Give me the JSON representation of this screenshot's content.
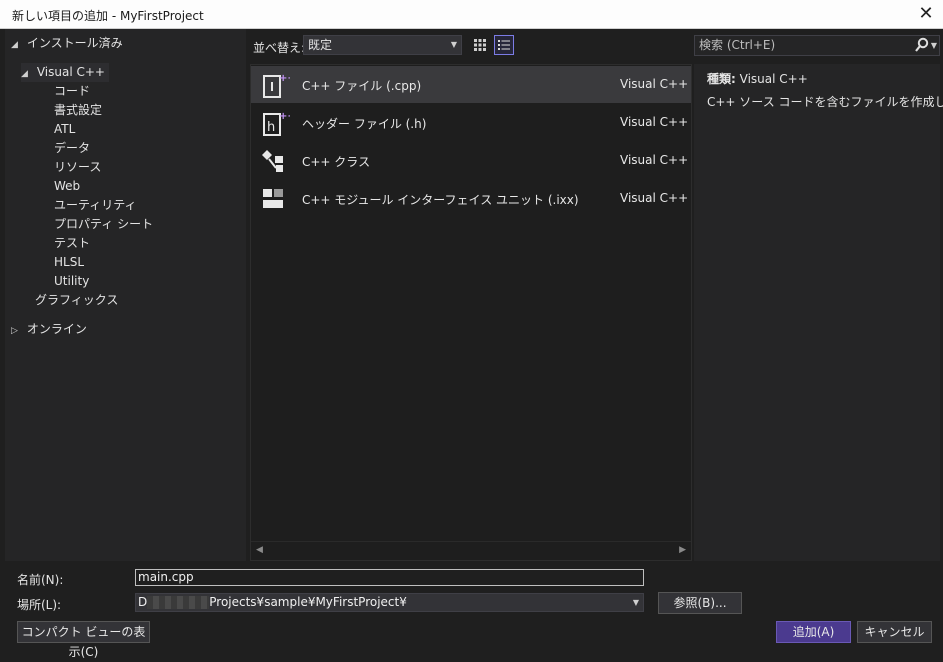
{
  "window": {
    "title": "新しい項目の追加 - MyFirstProject",
    "close_glyph": "✕"
  },
  "tree": {
    "installed": "インストール済み",
    "visual_cpp": "Visual C++",
    "children": [
      "コード",
      "書式設定",
      "ATL",
      "データ",
      "リソース",
      "Web",
      "ユーティリティ",
      "プロパティ シート",
      "テスト",
      "HLSL",
      "Utility"
    ],
    "graphics": "グラフィックス",
    "online": "オンライン"
  },
  "toolbar": {
    "sort_label": "並べ替え:",
    "sort_value": "既定"
  },
  "templates": [
    {
      "name": "C++ ファイル (.cpp)",
      "lang": "Visual C++",
      "icon": "cpp-file-icon"
    },
    {
      "name": "ヘッダー ファイル (.h)",
      "lang": "Visual C++",
      "icon": "header-file-icon"
    },
    {
      "name": "C++ クラス",
      "lang": "Visual C++",
      "icon": "cpp-class-icon"
    },
    {
      "name": "C++ モジュール インターフェイス ユニット (.ixx)",
      "lang": "Visual C++",
      "icon": "module-unit-icon"
    }
  ],
  "search": {
    "placeholder": "検索 (Ctrl+E)"
  },
  "details": {
    "type_label": "種類:",
    "type_value": "Visual C++",
    "description": "C++ ソース コードを含むファイルを作成します"
  },
  "form": {
    "name_label": "名前(N):",
    "name_value": "main.cpp",
    "location_label": "場所(L):",
    "location_prefix": "D",
    "location_suffix": "Projects¥sample¥MyFirstProject¥",
    "browse_label": "参照(B)..."
  },
  "buttons": {
    "compact_view": "コンパクト ビューの表示(C)",
    "add": "追加(A)",
    "cancel": "キャンセル"
  },
  "colors": {
    "accent": "#4b3a8f",
    "background": "#1f1f1f",
    "panel": "#252526",
    "icon_purple": "#b084f5"
  }
}
